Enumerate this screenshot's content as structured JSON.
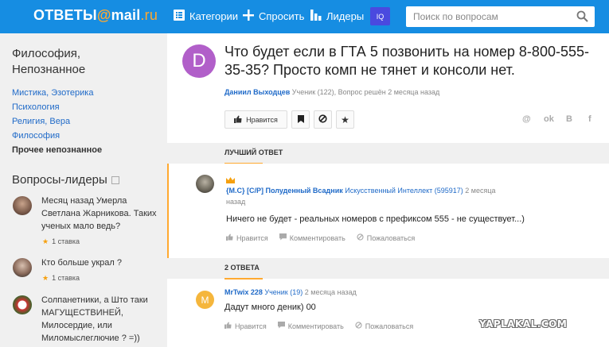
{
  "header": {
    "logo_main": "ОТВЕТЫ",
    "logo_at": "@",
    "logo_mail": "mail",
    "logo_ru": ".ru",
    "nav": {
      "categories": "Категории",
      "ask": "Спросить",
      "leaders": "Лидеры"
    },
    "iq_badge": "IQ",
    "search_placeholder": "Поиск по вопросам"
  },
  "sidebar": {
    "category_title": "Философия, Непознанное",
    "links": [
      "Мистика, Эзотерика",
      "Психология",
      "Религия, Вера",
      "Философия"
    ],
    "current_link": "Прочее непознанное",
    "leaders_title": "Вопросы-лидеры",
    "leaders": [
      {
        "text": "Месяц назад Умерла Светлана Жарникова. Таких ученых мало ведь?",
        "stake": "1 ставка"
      },
      {
        "text": "Кто больше украл ?",
        "stake": "1 ставка"
      },
      {
        "text": "Солпанетники, а Што таки МАГУЩЕСТВИНЕЙ, Милосердие, или Миломыслеглючие ? =))",
        "stake": ""
      }
    ]
  },
  "question": {
    "avatar_letter": "D",
    "title": "Что будет если в ГТА 5 позвонить на номер 8-800-555-35-35? Просто комп не тянет и консоли нет.",
    "author": "Даниил Выходцев",
    "author_info": "Ученик (122), Вопрос решён 2 месяца назад",
    "like_label": "Нравится",
    "share": [
      "@",
      "ok",
      "В",
      "f"
    ]
  },
  "best_answer": {
    "section_label": "ЛУЧШИЙ ОТВЕТ",
    "author": "{M.C} [C/P] Полуденный Всадник",
    "rank": "Искусственный Интеллект (595917)",
    "time": "2 месяца назад",
    "text": "Ничего не будет - реальных номеров с префиксом 555 - не существует...)",
    "actions": {
      "like": "Нравится",
      "comment": "Комментировать",
      "report": "Пожаловаться"
    }
  },
  "answers": {
    "section_label": "2 ОТВЕТА",
    "items": [
      {
        "avatar_letter": "M",
        "author": "MrTwix 228",
        "rank": "Ученик (19)",
        "time": "2 месяца назад",
        "text": "Дадут много деник) 00",
        "actions": {
          "like": "Нравится",
          "comment": "Комментировать",
          "report": "Пожаловаться"
        }
      }
    ]
  },
  "watermark": "YAPLAKAL.COM",
  "colors": {
    "header_bg": "#168de2",
    "accent_orange": "#ffa930",
    "link_blue": "#1f6ac8",
    "question_avatar": "#b15fc9",
    "answer_avatar": "#f5b63c"
  }
}
